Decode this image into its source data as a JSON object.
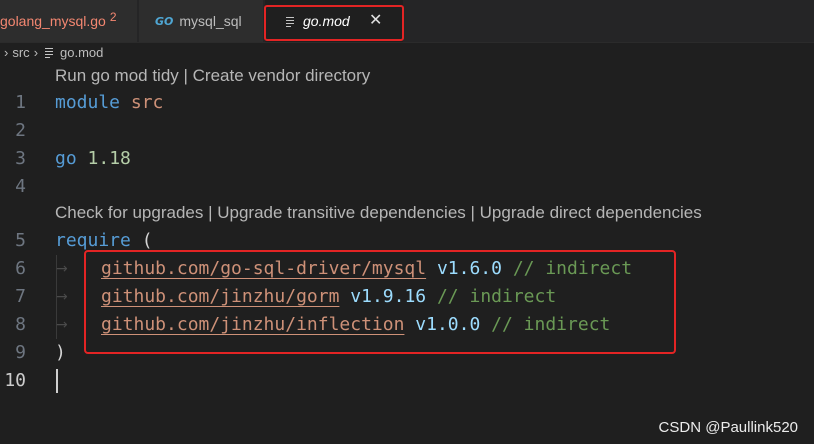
{
  "tabs": [
    {
      "label": "golang_mysql.go",
      "badge": "2"
    },
    {
      "label": "mysql_sql",
      "icon": "go-icon"
    },
    {
      "label": "go.mod",
      "icon": "file-lines-icon",
      "close": "✕"
    }
  ],
  "breadcrumb": {
    "chevron": "›",
    "folder": "src",
    "file": "go.mod"
  },
  "codelens": {
    "top": "Run go mod tidy | Create vendor directory",
    "require": "Check for upgrades | Upgrade transitive dependencies | Upgrade direct dependencies"
  },
  "lines": {
    "1": {
      "num": "1",
      "kw": "module",
      "value": "src"
    },
    "2": {
      "num": "2"
    },
    "3": {
      "num": "3",
      "kw": "go",
      "value": "1.18"
    },
    "4": {
      "num": "4"
    },
    "5": {
      "num": "5",
      "kw": "require",
      "paren": "("
    },
    "6": {
      "num": "6",
      "module": "github.com/go-sql-driver/mysql",
      "version": "v1.6.0",
      "comment": "// indirect"
    },
    "7": {
      "num": "7",
      "module": "github.com/jinzhu/gorm",
      "version": "v1.9.16",
      "comment": "// indirect"
    },
    "8": {
      "num": "8",
      "module": "github.com/jinzhu/inflection",
      "version": "v1.0.0",
      "comment": "// indirect"
    },
    "9": {
      "num": "9",
      "paren": ")"
    },
    "10": {
      "num": "10"
    }
  },
  "tab_glyph": "→",
  "watermark": "CSDN @Paullink520",
  "colors": {
    "keyword": "#569cd6",
    "string": "#ce9178",
    "number": "#b5cea8",
    "version": "#9cdcfe",
    "comment": "#6a9955",
    "highlight": "#e32424"
  }
}
